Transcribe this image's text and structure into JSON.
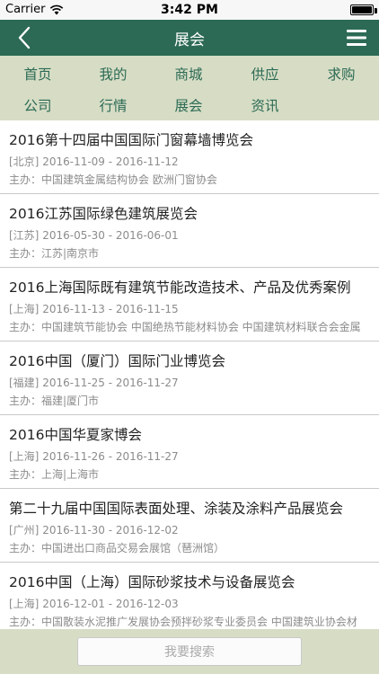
{
  "status_bar": {
    "carrier": "Carrier",
    "time": "3:42 PM"
  },
  "header": {
    "title": "展会"
  },
  "categories": [
    "首页",
    "我的",
    "商城",
    "供应",
    "求购",
    "公司",
    "行情",
    "展会",
    "资讯"
  ],
  "exhibitions": [
    {
      "title": "2016第十四届中国国际门窗幕墙博览会",
      "region": "[北京]",
      "dates": "2016-11-09 - 2016-11-12",
      "host": "主办：中国建筑金属结构协会 欧洲门窗协会"
    },
    {
      "title": "2016江苏国际绿色建筑展览会",
      "region": "[江苏]",
      "dates": "2016-05-30 - 2016-06-01",
      "host": "主办：江苏|南京市"
    },
    {
      "title": "2016上海国际既有建筑节能改造技术、产品及优秀案例",
      "region": "[上海]",
      "dates": "2016-11-13 - 2016-11-15",
      "host": "主办：中国建筑节能协会 中国绝热节能材料协会 中国建筑材料联合会金属"
    },
    {
      "title": "2016中国（厦门）国际门业博览会",
      "region": "[福建]",
      "dates": "2016-11-25 - 2016-11-27",
      "host": "主办：福建|厦门市"
    },
    {
      "title": "2016中国华夏家博会",
      "region": "[上海]",
      "dates": "2016-11-26 - 2016-11-27",
      "host": "主办：上海|上海市"
    },
    {
      "title": "第二十九届中国国际表面处理、涂装及涂料产品展览会",
      "region": "[广州]",
      "dates": "2016-11-30 - 2016-12-02",
      "host": "主办：中国进出口商品交易会展馆（琶洲馆）"
    },
    {
      "title": "2016中国（上海）国际砂浆技术与设备展览会",
      "region": "[上海]",
      "dates": "2016-12-01 - 2016-12-03",
      "host": "主办：中国散装水泥推广发展协会预拌砂浆专业委员会 中国建筑业协会材"
    }
  ],
  "search": {
    "label": "我要搜索"
  }
}
